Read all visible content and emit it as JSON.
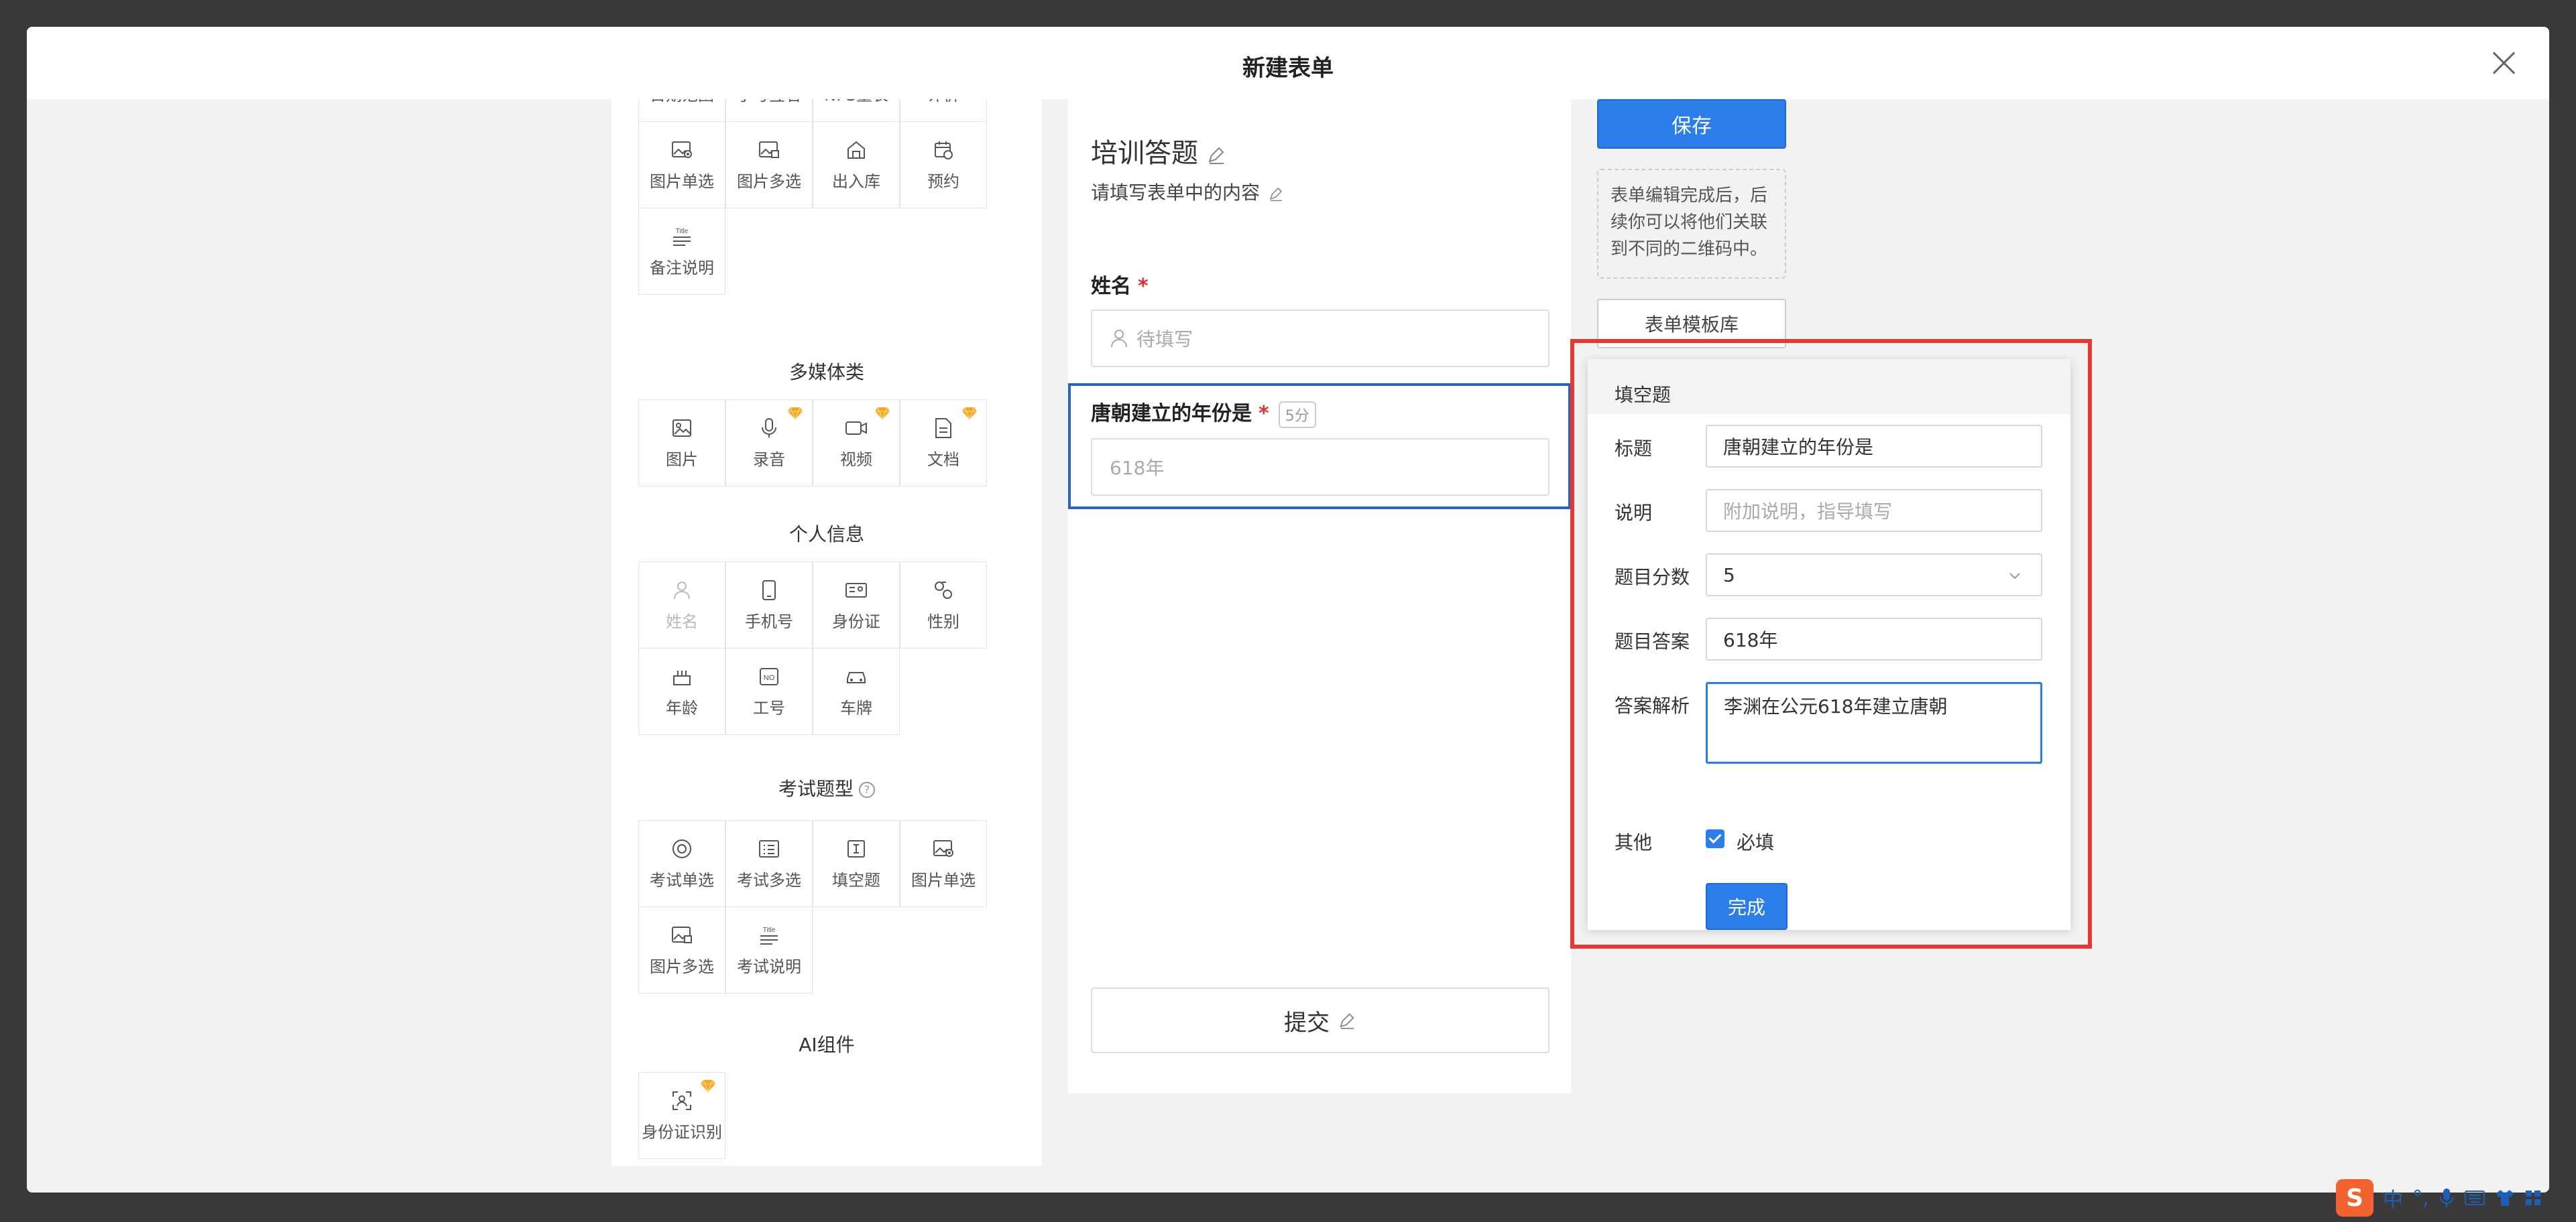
{
  "modal": {
    "title": "新建表单"
  },
  "palette": {
    "partial_row": [
      "日期范围",
      "手写签名",
      "NPS量表",
      "评价"
    ],
    "basic_rows": [
      [
        "图片单选",
        "图片多选",
        "出入库",
        "预约"
      ],
      [
        "备注说明"
      ]
    ],
    "multimedia": {
      "title": "多媒体类",
      "items": [
        "图片",
        "录音",
        "视频",
        "文档"
      ]
    },
    "personal": {
      "title": "个人信息",
      "rows": [
        [
          "姓名",
          "手机号",
          "身份证",
          "性别"
        ],
        [
          "年龄",
          "工号",
          "车牌"
        ]
      ]
    },
    "exam": {
      "title": "考试题型",
      "rows": [
        [
          "考试单选",
          "考试多选",
          "填空题",
          "图片单选"
        ],
        [
          "图片多选",
          "考试说明"
        ]
      ]
    },
    "ai": {
      "title": "AI组件",
      "items": [
        "身份证识别"
      ]
    }
  },
  "form": {
    "title": "培训答题",
    "subtitle": "请填写表单中的内容",
    "q1": {
      "label": "姓名",
      "required_mark": "*",
      "placeholder": "待填写"
    },
    "q2": {
      "label": "唐朝建立的年份是",
      "required_mark": "*",
      "score": "5分",
      "value": "618年"
    },
    "submit": "提交"
  },
  "side": {
    "save": "保存",
    "tip": "表单编辑完成后，后续你可以将他们关联到不同的二维码中。",
    "template": "表单模板库"
  },
  "panel": {
    "header": "填空题",
    "title_label": "标题",
    "title_value": "唐朝建立的年份是",
    "desc_label": "说明",
    "desc_placeholder": "附加说明，指导填写",
    "score_label": "题目分数",
    "score_value": "5",
    "answer_label": "题目答案",
    "answer_value": "618年",
    "analysis_label": "答案解析",
    "analysis_value": "李渊在公元618年建立唐朝",
    "other_label": "其他",
    "required_label": "必填",
    "done": "完成"
  },
  "ime": {
    "s_glyph": "S",
    "lang": "中",
    "punct": "°,"
  },
  "colors": {
    "accent": "#2b7de9",
    "highlight": "#e53935",
    "required": "#e03030"
  }
}
